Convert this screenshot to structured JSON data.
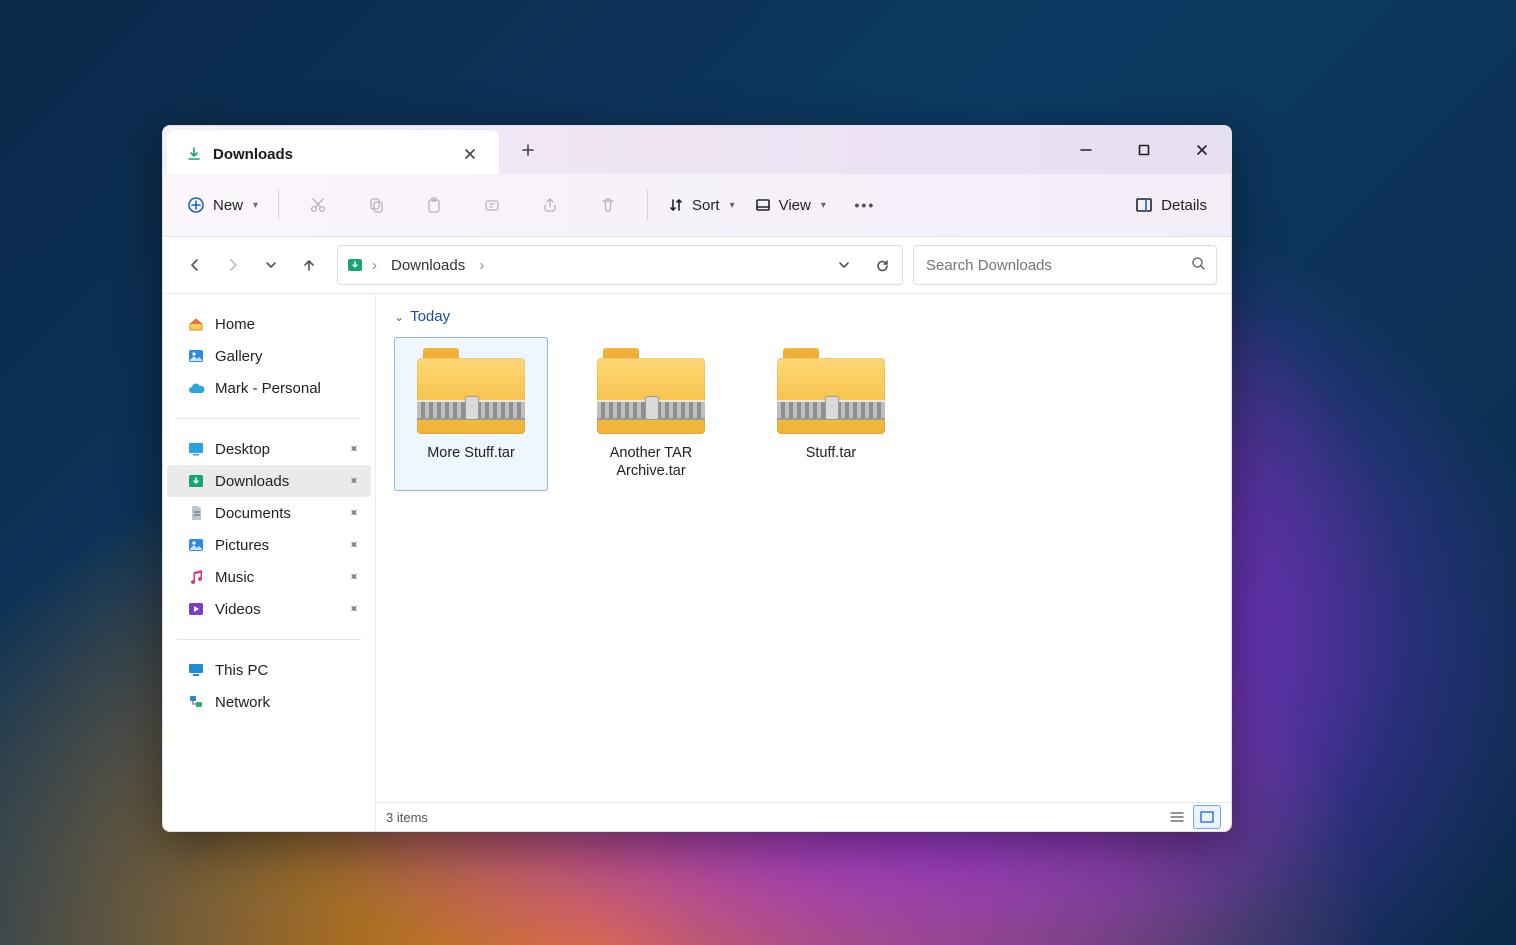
{
  "tab": {
    "title": "Downloads"
  },
  "toolbar": {
    "new_label": "New",
    "sort_label": "Sort",
    "view_label": "View",
    "details_label": "Details"
  },
  "breadcrumb": {
    "current": "Downloads"
  },
  "search": {
    "placeholder": "Search Downloads"
  },
  "sidebar": {
    "top": [
      {
        "label": "Home"
      },
      {
        "label": "Gallery"
      },
      {
        "label": "Mark - Personal"
      }
    ],
    "quick": [
      {
        "label": "Desktop"
      },
      {
        "label": "Downloads"
      },
      {
        "label": "Documents"
      },
      {
        "label": "Pictures"
      },
      {
        "label": "Music"
      },
      {
        "label": "Videos"
      }
    ],
    "bottom": [
      {
        "label": "This PC"
      },
      {
        "label": "Network"
      }
    ],
    "active": "Downloads"
  },
  "group": {
    "label": "Today"
  },
  "files": [
    {
      "name": "More Stuff.tar",
      "selected": true
    },
    {
      "name": "Another TAR Archive.tar",
      "selected": false
    },
    {
      "name": "Stuff.tar",
      "selected": false
    }
  ],
  "status": {
    "count_text": "3 items"
  }
}
